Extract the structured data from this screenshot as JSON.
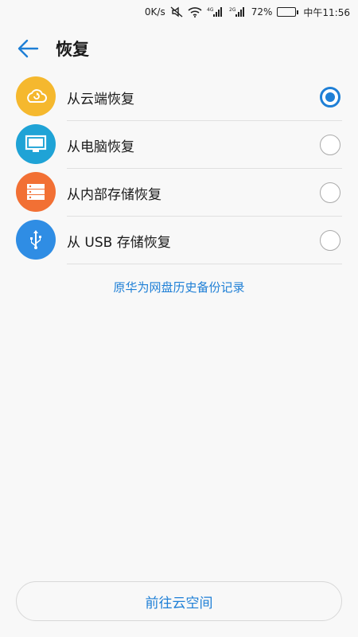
{
  "status_bar": {
    "speed": "0K/s",
    "signal1_type": "4G",
    "signal2_type": "2G",
    "battery": "72%",
    "battery_level": 0.72,
    "time": "中午11:56"
  },
  "header": {
    "title": "恢复",
    "back_icon": "arrow-left-icon"
  },
  "options": [
    {
      "label": "从云端恢复",
      "icon": "cloud-restore-icon",
      "color": "#f5b82e",
      "selected": true
    },
    {
      "label": "从电脑恢复",
      "icon": "monitor-icon",
      "color": "#1fa3d6",
      "selected": false
    },
    {
      "label": "从内部存储恢复",
      "icon": "storage-icon",
      "color": "#f27034",
      "selected": false
    },
    {
      "label": "从 USB 存储恢复",
      "icon": "usb-icon",
      "color": "#2f8de4",
      "selected": false
    }
  ],
  "history_link": "原华为网盘历史备份记录",
  "bottom_button": "前往云空间",
  "colors": {
    "accent": "#1e7fd6"
  }
}
